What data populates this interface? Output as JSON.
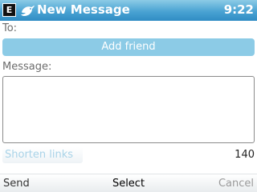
{
  "header": {
    "app_icon_letter": "E",
    "title": "New Message",
    "time": "9:22",
    "bird_icon": "bird-icon",
    "bar_color": "#4aa3d3"
  },
  "form": {
    "to_label": "To:",
    "add_friend_label": "Add friend",
    "message_label": "Message:",
    "message_value": "",
    "shorten_links_label": "Shorten links",
    "char_count": "140"
  },
  "softkeys": {
    "left": "Send",
    "center": "Select",
    "right": "Cancel"
  }
}
